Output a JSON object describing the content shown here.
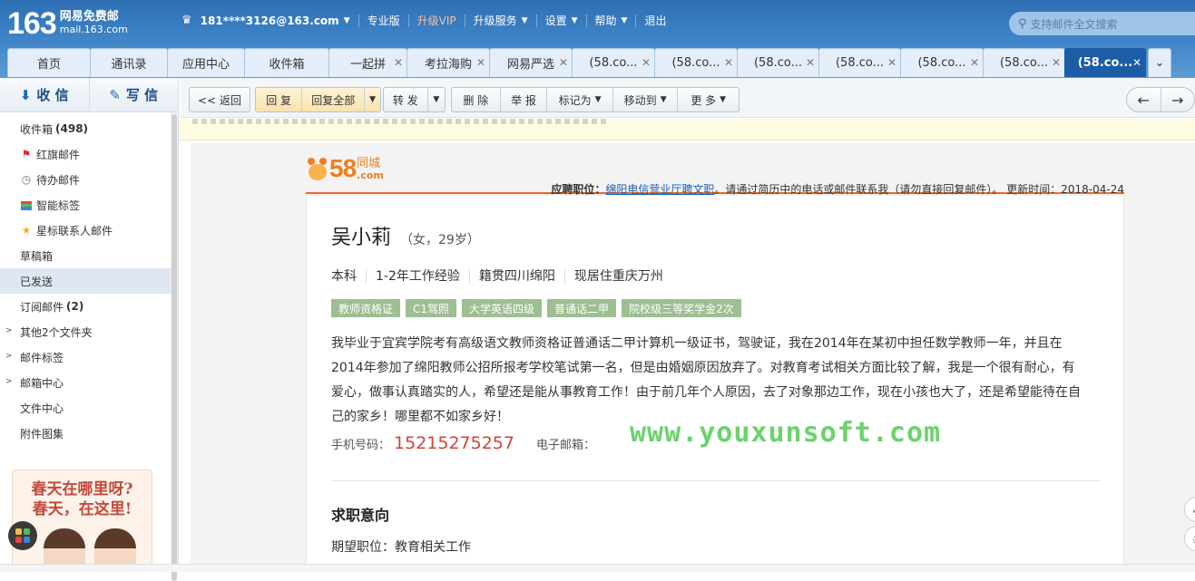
{
  "brand": {
    "number": "163",
    "name": "网易免费邮",
    "domain": "mail.163.com"
  },
  "topnav": {
    "account": "181****3126@163.com",
    "items": [
      "专业版",
      "升级VIP",
      "升级服务",
      "设置",
      "帮助",
      "退出"
    ]
  },
  "search": {
    "placeholder": "支持邮件全文搜索"
  },
  "tabs": [
    {
      "label": "首页",
      "closable": false
    },
    {
      "label": "通讯录",
      "closable": false
    },
    {
      "label": "应用中心",
      "closable": false
    },
    {
      "label": "收件箱",
      "closable": false
    },
    {
      "label": "一起拼",
      "closable": true
    },
    {
      "label": "考拉海购",
      "closable": true
    },
    {
      "label": "网易严选",
      "closable": true
    },
    {
      "label": "(58.co...",
      "closable": true
    },
    {
      "label": "(58.co...",
      "closable": true
    },
    {
      "label": "(58.co...",
      "closable": true
    },
    {
      "label": "(58.co...",
      "closable": true
    },
    {
      "label": "(58.co...",
      "closable": true
    },
    {
      "label": "(58.co...",
      "closable": true
    },
    {
      "label": "(58.co...",
      "closable": true,
      "active": true
    }
  ],
  "sidebar": {
    "receive": "收 信",
    "compose": "写 信",
    "folders": [
      {
        "label": "收件箱",
        "count": "(498)",
        "icon": ""
      },
      {
        "label": "红旗邮件",
        "icon": "red-flag-icon"
      },
      {
        "label": "待办邮件",
        "icon": "clock-icon"
      },
      {
        "label": "智能标签",
        "icon": "tag-stack-icon"
      },
      {
        "label": "星标联系人邮件",
        "icon": "star-icon"
      },
      {
        "label": "草稿箱",
        "icon": ""
      },
      {
        "label": "已发送",
        "icon": "",
        "selected": true
      },
      {
        "label": "订阅邮件",
        "count": "(2)",
        "icon": ""
      },
      {
        "label": "其他2个文件夹",
        "expandable": true
      },
      {
        "label": "邮件标签",
        "expandable": true
      },
      {
        "label": "邮箱中心",
        "expandable": true
      },
      {
        "label": "文件中心",
        "icon": ""
      },
      {
        "label": "附件图集",
        "icon": ""
      }
    ],
    "promo": {
      "line1": "春天在哪里呀?",
      "line2": "春天，在这里!"
    }
  },
  "toolbar": {
    "back": "<< 返回",
    "reply": "回 复",
    "reply_all": "回复全部",
    "forward": "转 发",
    "delete": "删 除",
    "report": "举 报",
    "mark_as": "标记为",
    "move_to": "移动到",
    "more": "更 多",
    "prev": "←",
    "next": "→"
  },
  "mail": {
    "site_logo_num": "58",
    "site_logo_cn": "同城",
    "site_logo_com": ".com",
    "job_label": "应聘职位：",
    "job_title": "绵阳电信营业厅聘文职",
    "job_note": "。请通过简历中的电话或邮件联系我（请勿直接回复邮件）。 更新时间：",
    "updated": "2018-04-24",
    "name": "吴小莉",
    "gender_age": "（女，29岁）",
    "info": [
      "本科",
      "1-2年工作经验",
      "籍贯四川绵阳",
      "现居住重庆万州"
    ],
    "tags": [
      "教师资格证",
      "C1驾照",
      "大学英语四级",
      "普通话二甲",
      "院校级三等奖学金2次"
    ],
    "intro": "我毕业于宜宾学院考有高级语文教师资格证普通话二甲计算机一级证书，驾驶证，我在2014年在某初中担任数学教师一年，并且在2014年参加了绵阳教师公招所报考学校笔试第一名，但是由婚姻原因放弃了。对教育考试相关方面比较了解，我是一个很有耐心，有爱心，做事认真踏实的人，希望还是能从事教育工作！由于前几年个人原因，去了对象那边工作，现在小孩也大了，还是希望能待在自己的家乡！哪里都不如家乡好！",
    "phone_label": "手机号码：",
    "phone": "15215275257",
    "email_label": "电子邮箱：",
    "section_title": "求职意向",
    "expect_label": "期望职位：教育相关工作"
  },
  "watermark": "www.youxunsoft.com"
}
